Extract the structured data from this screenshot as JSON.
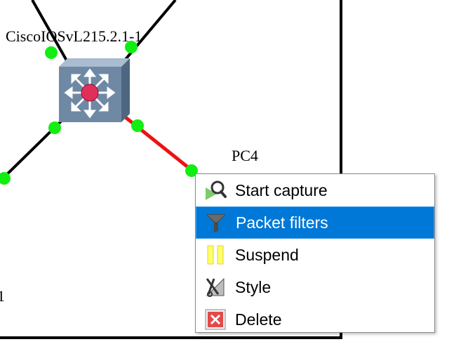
{
  "topology": {
    "nodes": [
      {
        "id": "switch",
        "label": "CiscoIOSvL215.2.1-1"
      },
      {
        "id": "pc4",
        "label": "PC4"
      },
      {
        "id": "partial",
        "label": "1"
      }
    ]
  },
  "context_menu": {
    "items": [
      {
        "label": "Start capture",
        "icon": "start-capture-icon"
      },
      {
        "label": "Packet filters",
        "icon": "packet-filter-icon",
        "selected": true
      },
      {
        "label": "Suspend",
        "icon": "suspend-icon"
      },
      {
        "label": "Style",
        "icon": "style-icon"
      },
      {
        "label": "Delete",
        "icon": "delete-icon"
      }
    ]
  },
  "colors": {
    "link": "#000000",
    "captured_link": "#ee1111",
    "port": "#11ee11",
    "menu_highlight": "#0078d7"
  }
}
